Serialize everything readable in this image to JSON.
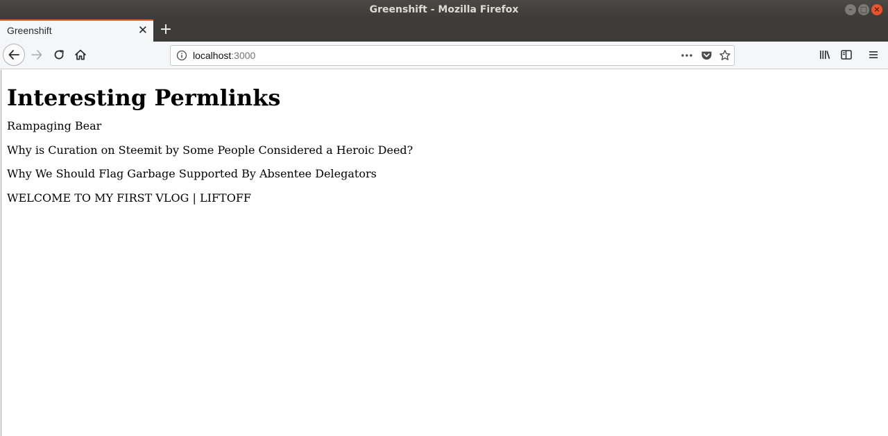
{
  "window": {
    "title": "Greenshift - Mozilla Firefox",
    "controls": [
      "minimize-icon",
      "maximize-icon",
      "close-icon"
    ]
  },
  "tabs": [
    {
      "label": "Greenshift",
      "active": true
    }
  ],
  "toolbar": {
    "new_tab_icon": "plus-icon",
    "back_icon": "arrow-left-icon",
    "forward_icon": "arrow-right-icon",
    "reload_icon": "reload-icon",
    "home_icon": "home-icon",
    "library_icon": "library-icon",
    "sidebar_icon": "sidebar-icon",
    "menu_icon": "hamburger-menu-icon"
  },
  "urlbar": {
    "host": "localhost",
    "port": ":3000",
    "info_icon": "info-icon",
    "page_actions_icon": "ellipsis-icon",
    "pocket_icon": "pocket-icon",
    "bookmark_icon": "star-icon"
  },
  "page": {
    "heading": "Interesting Permlinks",
    "links": [
      "Rampaging Bear",
      "Why is Curation on Steemit by Some People Considered a Heroic Deed?",
      "Why We Should Flag Garbage Supported By Absentee Delegators",
      "WELCOME TO MY FIRST VLOG | LIFTOFF"
    ]
  },
  "colors": {
    "titlebar": "#3c3b37",
    "active_tab_accent": "#e66330",
    "toolbar": "#f5f6f7",
    "close_button": "#e9552a"
  }
}
